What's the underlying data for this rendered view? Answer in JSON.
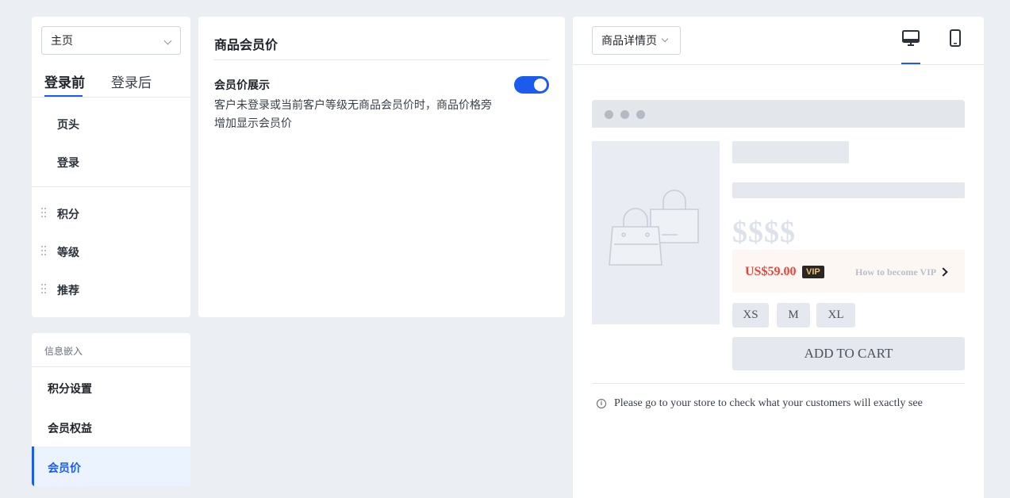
{
  "nav": {
    "page_select_value": "主页",
    "tabs": [
      {
        "label": "登录前",
        "active": true
      },
      {
        "label": "登录后",
        "active": false
      }
    ],
    "fixed_items": [
      "页头",
      "登录"
    ],
    "draggable_items": [
      "积分",
      "等级",
      "推荐"
    ]
  },
  "embed": {
    "heading": "信息嵌入",
    "items": [
      "积分设置",
      "会员权益",
      "会员价"
    ],
    "active_item": "会员价"
  },
  "settings": {
    "title": "商品会员价",
    "option_title": "会员价展示",
    "option_desc": "客户未登录或当前客户等级无商品会员价时，商品价格旁增加显示会员价",
    "toggle_on": true
  },
  "preview": {
    "page_select_value": "商品详情页",
    "device_active": "desktop",
    "price_mask": "$$$$",
    "vip_price": "US$59.00",
    "vip_badge": "VIP",
    "vip_link": "How to become VIP",
    "sizes": [
      "XS",
      "M",
      "XL"
    ],
    "cart_label": "ADD TO CART",
    "notice": "Please go to your store to check what your customers will exactly see",
    "accent_color": "#1b5cef"
  }
}
